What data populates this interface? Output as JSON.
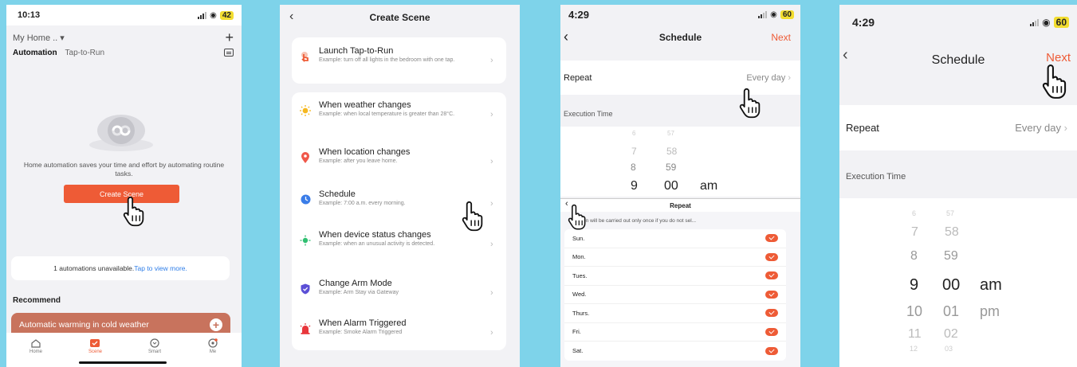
{
  "screen1": {
    "time": "10:13",
    "battery": "42",
    "home_label": "My Home ..",
    "tab_automation": "Automation",
    "tab_tap": "Tap-to-Run",
    "empty_text": "Home automation saves your time and effort by automating routine tasks.",
    "create_btn": "Create Scene",
    "unavailable_text": "1 automations unavailable.",
    "unavailable_link": "Tap to view more.",
    "recommend": "Recommend",
    "rec_card": "Automatic warming in cold weather",
    "nav": [
      "Home",
      "Scene",
      "Smart",
      "Me"
    ],
    "accent": "#ee5b36"
  },
  "screen2": {
    "title": "Create Scene",
    "items": [
      {
        "title": "Launch Tap-to-Run",
        "example": "Example: turn off all lights in the bedroom with one tap."
      },
      {
        "title": "When weather changes",
        "example": "Example: when local temperature is greater than 28°C."
      },
      {
        "title": "When location changes",
        "example": "Example: after you leave home."
      },
      {
        "title": "Schedule",
        "example": "Example: 7:00 a.m. every morning."
      },
      {
        "title": "When device status changes",
        "example": "Example: when an unusual activity is detected."
      },
      {
        "title": "Change Arm Mode",
        "example": "Example: Arm Stay via Gateway"
      },
      {
        "title": "When Alarm Triggered",
        "example": "Example: Smoke Alarm Triggered"
      }
    ]
  },
  "screen3": {
    "time": "4:29",
    "battery": "60",
    "title": "Schedule",
    "next": "Next",
    "repeat_label": "Repeat",
    "repeat_value": "Every day",
    "exec_label": "Execution Time",
    "hours": [
      "6",
      "7",
      "8",
      "9"
    ],
    "minutes": [
      "57",
      "58",
      "59",
      "00"
    ],
    "ampm": "am",
    "sheet_title": "Repeat",
    "sheet_note": "action will be carried out only once if you do not sel...",
    "days": [
      "Sun.",
      "Mon.",
      "Tues.",
      "Wed.",
      "Thurs.",
      "Fri.",
      "Sat."
    ]
  },
  "screen4": {
    "time": "4:29",
    "battery": "60",
    "title": "Schedule",
    "next": "Next",
    "repeat_label": "Repeat",
    "repeat_value": "Every day",
    "exec_label": "Execution Time",
    "hours": [
      "6",
      "7",
      "8",
      "9",
      "10",
      "11",
      "12"
    ],
    "minutes": [
      "57",
      "58",
      "59",
      "00",
      "01",
      "02",
      "03"
    ],
    "ampm": [
      "am",
      "pm"
    ]
  }
}
